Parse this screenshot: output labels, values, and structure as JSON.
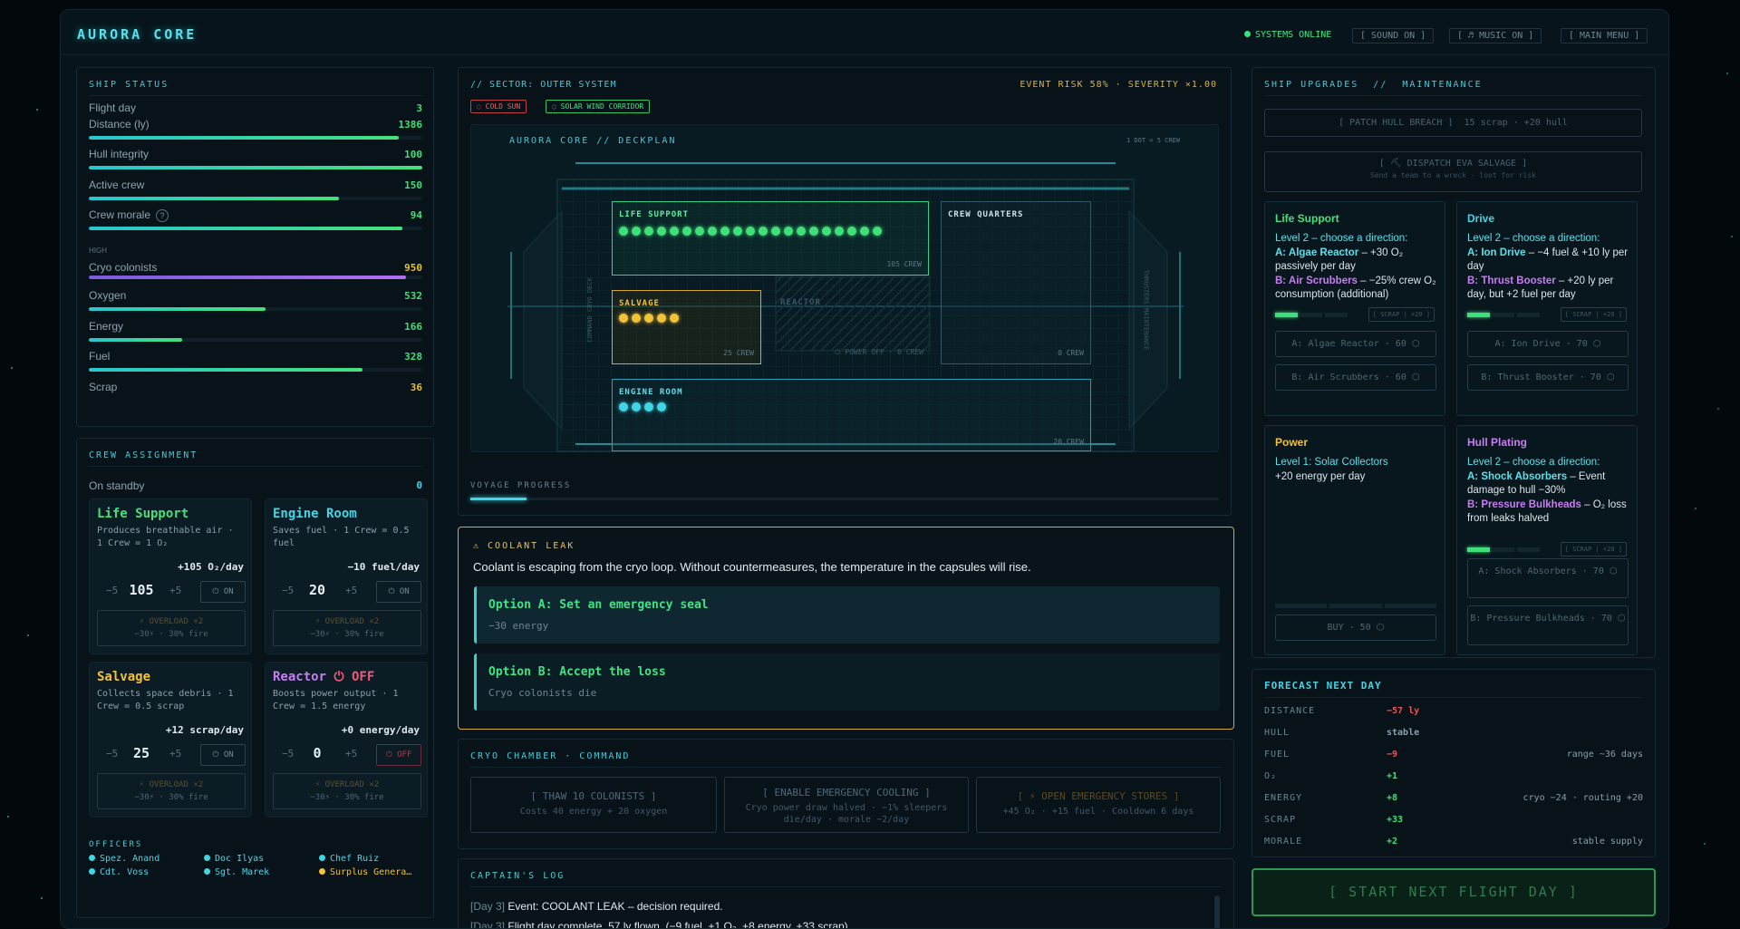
{
  "header": {
    "brand": "AURORA CORE",
    "status": "SYSTEMS ONLINE",
    "sound": "[ SOUND ON ]",
    "music": "[ ♬ MUSIC ON ]",
    "menu": "[ MAIN MENU ]"
  },
  "ship_status": {
    "title": "SHIP STATUS",
    "morale_level": "HIGH",
    "stats": [
      {
        "label": "Flight day",
        "value": "3",
        "color": "#3fe07a"
      },
      {
        "label": "Distance (ly)",
        "value": "1386",
        "color": "#3fe07a",
        "level": 0.93
      },
      {
        "label": "Hull integrity",
        "value": "100",
        "color": "#3fe07a",
        "level": 1.0
      },
      {
        "label": "Active crew",
        "value": "150",
        "color": "#3fe07a",
        "level": 0.75
      },
      {
        "label": "Crew morale",
        "value": "94",
        "color": "#3fe07a",
        "level": 0.94
      },
      {
        "label": "Cryo colonists",
        "value": "950",
        "color": "#e6c02f",
        "level": 0.95
      },
      {
        "label": "Oxygen",
        "value": "532",
        "color": "#3fe07a",
        "level": 0.53
      },
      {
        "label": "Energy",
        "value": "166",
        "color": "#3fe07a",
        "level": 0.28
      },
      {
        "label": "Fuel",
        "value": "328",
        "color": "#3fe07a",
        "level": 0.82
      },
      {
        "label": "Scrap",
        "value": "36",
        "color": "#e6c02f"
      }
    ]
  },
  "crew_assignment": {
    "title": "CREW ASSIGNMENT",
    "standby_label": "On standby",
    "standby_value": "0",
    "rooms": [
      {
        "name": "Life Support",
        "color": "#46e07c",
        "desc": "Produces breathable air · 1 Crew = 1 O₂",
        "rate": "+105 O₂/day",
        "count": "105",
        "toggle": "⏻ ON",
        "overload": "⚡ OVERLOAD ×2",
        "overload_sub": "−30⚡ · 30% fire"
      },
      {
        "name": "Engine Room",
        "color": "#3fd7e6",
        "desc": "Saves fuel · 1 Crew = 0.5 fuel",
        "rate": "−10 fuel/day",
        "count": "20",
        "toggle": "⏻ ON",
        "overload": "⚡ OVERLOAD ×2",
        "overload_sub": "−30⚡ · 30% fire"
      },
      {
        "name": "Salvage",
        "color": "#f2c23a",
        "desc": "Collects space debris · 1 Crew = 0.5 scrap",
        "rate": "+12 scrap/day",
        "count": "25",
        "toggle": "⏻ ON",
        "overload": "⚡ OVERLOAD ×2",
        "overload_sub": "−30⚡ · 30% fire"
      },
      {
        "name": "Reactor",
        "status": "⏻ OFF",
        "color": "#c77ef0",
        "desc": "Boosts power output · 1 Crew = 1.5 energy",
        "rate": "+0 energy/day",
        "count": "0",
        "toggle": "⏻ OFF",
        "overload": "⚡ OVERLOAD ×2",
        "overload_sub": "−30⚡ · 30% fire"
      }
    ],
    "officers_title": "OFFICERS",
    "officers": [
      "Spez. Anand",
      "Doc Ilyas",
      "Chef Ruiz",
      "Cdt. Voss",
      "Sgt. Marek",
      "Surplus Genera…"
    ]
  },
  "sector": {
    "title": "// SECTOR: OUTER SYSTEM",
    "risk": "EVENT RISK 58% · SEVERITY ×1.00",
    "tags": [
      "COLD SUN",
      "SOLAR WIND CORRIDOR"
    ],
    "deck_title": "AURORA CORE // DECKPLAN",
    "deck_legend": "1 DOT = 5 CREW",
    "side_left": "COMMAND CRYO DECK",
    "side_right": "THRUSTERS MAINTENANCE",
    "rooms": {
      "life": {
        "label": "LIFE SUPPORT",
        "crew": "105 CREW",
        "dots": 21
      },
      "quarters": {
        "label": "CREW QUARTERS",
        "crew": "0 CREW"
      },
      "salvage": {
        "label": "SALVAGE",
        "crew": "25 CREW",
        "dots": 5
      },
      "reactor": {
        "label": "REACTOR",
        "crew": "⏻ POWER OFF · 0 CREW"
      },
      "engine": {
        "label": "ENGINE ROOM",
        "crew": "20 CREW",
        "dots": 4
      }
    },
    "progress_label": "VOYAGE PROGRESS",
    "progress": 0.075
  },
  "event": {
    "title": "⚠ COOLANT LEAK",
    "text": "Coolant is escaping from the cryo loop. Without countermeasures, the temperature in the capsules will rise.",
    "options": [
      {
        "title": "Option A: Set an emergency seal",
        "sub": "−30 energy"
      },
      {
        "title": "Option B: Accept the loss",
        "sub": "Cryo colonists die"
      }
    ]
  },
  "cryo": {
    "title": "CRYO CHAMBER · COMMAND",
    "actions": [
      {
        "label": "[ THAW 10 COLONISTS ]",
        "sub": "Costs 40 energy + 20 oxygen"
      },
      {
        "label": "[ ENABLE EMERGENCY COOLING ]",
        "sub": "Cryo power draw halved · −1% sleepers die/day · morale −2/day"
      },
      {
        "label": "[ ⚡ OPEN EMERGENCY STORES ]",
        "sub": "+45 O₂ · +15 fuel · Cooldown 6 days"
      }
    ]
  },
  "log": {
    "title": "CAPTAIN'S LOG",
    "entries": [
      {
        "day": "[Day 3]",
        "text": "Event: COOLANT LEAK – decision required."
      },
      {
        "day": "[Day 3]",
        "text": "Flight day complete. 57 ly flown. (−9 fuel, +1 O₂, +8 energy, +33 scrap)"
      }
    ]
  },
  "upgrades": {
    "title": "SHIP UPGRADES  //  MAINTENANCE",
    "patch": "[ PATCH HULL BREACH ]  15 scrap · +20 hull",
    "eva": "[ ⛏ DISPATCH EVA SALVAGE ]",
    "eva_sub": "Send a team to a wreck · loot for risk",
    "cards": [
      {
        "name": "Life Support",
        "color": "#46e07c",
        "level": "Level 2 – choose a direction:",
        "a_name": "A: Algae Reactor",
        "a_text": " – +30 O₂ passively per day",
        "b_name": "B: Air Scrubbers",
        "b_text": " – −25% crew O₂ consumption (additional)",
        "scrap": "[ SCRAP | +20 ]",
        "btn_a": "A: Algae Reactor · 60 ⬡",
        "btn_b": "B: Air Scrubbers · 60 ⬡"
      },
      {
        "name": "Drive",
        "color": "#3fd7e6",
        "level": "Level 2 – choose a direction:",
        "a_name": "A: Ion Drive",
        "a_text": " – −4 fuel & +10 ly per day",
        "b_name": "B: Thrust Booster",
        "b_text": " – +20 ly per day, but +2 fuel per day",
        "scrap": "[ SCRAP | +20 ]",
        "btn_a": "A: Ion Drive · 70 ⬡",
        "btn_b": "B: Thrust Booster · 70 ⬡"
      },
      {
        "name": "Power",
        "color": "#f2c23a",
        "level": "Level 1: Solar Collectors",
        "text": "+20 energy per day",
        "buy": "BUY · 50 ⬡"
      },
      {
        "name": "Hull Plating",
        "color": "#c77ef0",
        "level": "Level 2 – choose a direction:",
        "a_name": "A: Shock Absorbers",
        "a_text": " – Event damage to hull −30%",
        "b_name": "B: Pressure Bulkheads",
        "b_text": " – O₂ loss from leaks halved",
        "scrap": "[ SCRAP | +20 ]",
        "btn_a": "A: Shock Absorbers · 70 ⬡",
        "btn_b": "B: Pressure Bulkheads · 70 ⬡"
      }
    ]
  },
  "forecast": {
    "title": "FORECAST NEXT DAY",
    "rows": [
      {
        "label": "DISTANCE",
        "value": "−57 ly",
        "color": "#f05555",
        "note": ""
      },
      {
        "label": "HULL",
        "value": "stable",
        "color": "#8aa0ab",
        "note": ""
      },
      {
        "label": "FUEL",
        "value": "−9",
        "color": "#f05555",
        "note": "range ~36 days"
      },
      {
        "label": "O₂",
        "value": "+1",
        "color": "#3fe07a",
        "note": ""
      },
      {
        "label": "ENERGY",
        "value": "+8",
        "color": "#3fe07a",
        "note": "cryo −24 · routing +20"
      },
      {
        "label": "SCRAP",
        "value": "+33",
        "color": "#3fe07a",
        "note": ""
      },
      {
        "label": "MORALE",
        "value": "+2",
        "color": "#3fe07a",
        "note": "stable supply"
      }
    ]
  },
  "start_button": "[ START NEXT FLIGHT DAY ]"
}
